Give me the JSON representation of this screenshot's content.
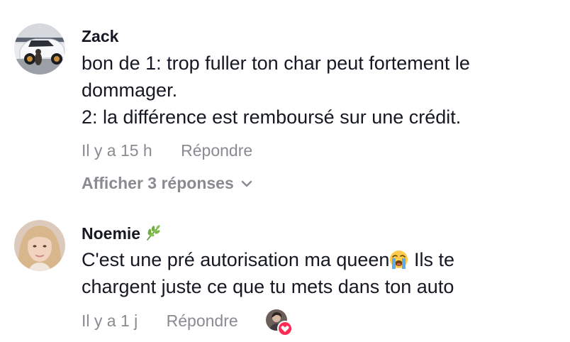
{
  "comments": [
    {
      "author": "Zack",
      "avatar_icon": "car-with-dog-avatar",
      "lines": [
        "bon de 1: trop fuller ton char peut fortement le",
        "dommager.",
        "2: la différence est remboursé sur une crédit."
      ],
      "time": "Il y a 15 h",
      "reply_label": "Répondre",
      "view_replies_label": "Afficher 3 réponses",
      "view_replies_icon": "chevron-down-icon"
    },
    {
      "author": "Noemie",
      "author_badge_icon": "herb-leaf-icon",
      "avatar_icon": "woman-portrait-avatar",
      "line1_before": "C'est une pré autorisation ma queen",
      "line1_emoji": "loudly-crying-face-emoji",
      "line1_after": " Ils te",
      "line2": "chargent juste ce que tu mets dans ton auto",
      "time": "Il y a 1 j",
      "reply_label": "Répondre",
      "liked_by_creator_icon": "creator-liked-heart-icon",
      "colors": {
        "heart": "#fe2c55"
      }
    }
  ],
  "colors": {
    "text_primary": "#161823",
    "text_secondary": "#8a8b91"
  }
}
